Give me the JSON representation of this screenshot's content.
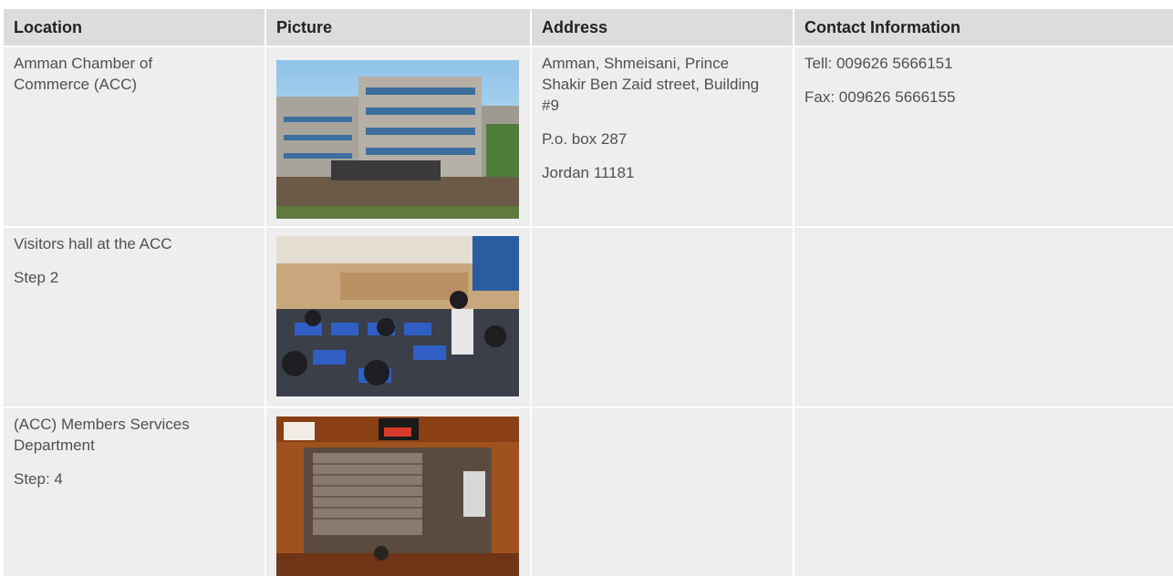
{
  "headers": [
    "Location",
    "Picture",
    "Address",
    "Contact Information"
  ],
  "rows": [
    {
      "location": [
        "Amman Chamber of Commerce (ACC)"
      ],
      "address": [
        "Amman, Shmeisani, Prince Shakir Ben Zaid street, Building #9",
        "P.o. box 287",
        "Jordan 11181"
      ],
      "contact": [
        "Tell: 009626 5666151",
        "Fax: 009626 5666155"
      ]
    },
    {
      "location": [
        "Visitors hall at the ACC",
        "Step 2"
      ],
      "address": [],
      "contact": []
    },
    {
      "location": [
        "(ACC) Members Services Department",
        "Step: 4"
      ],
      "address": [],
      "contact": []
    }
  ],
  "colors": {
    "header_bg": "#dcdcdc",
    "cell_bg": "#eeeeee"
  }
}
